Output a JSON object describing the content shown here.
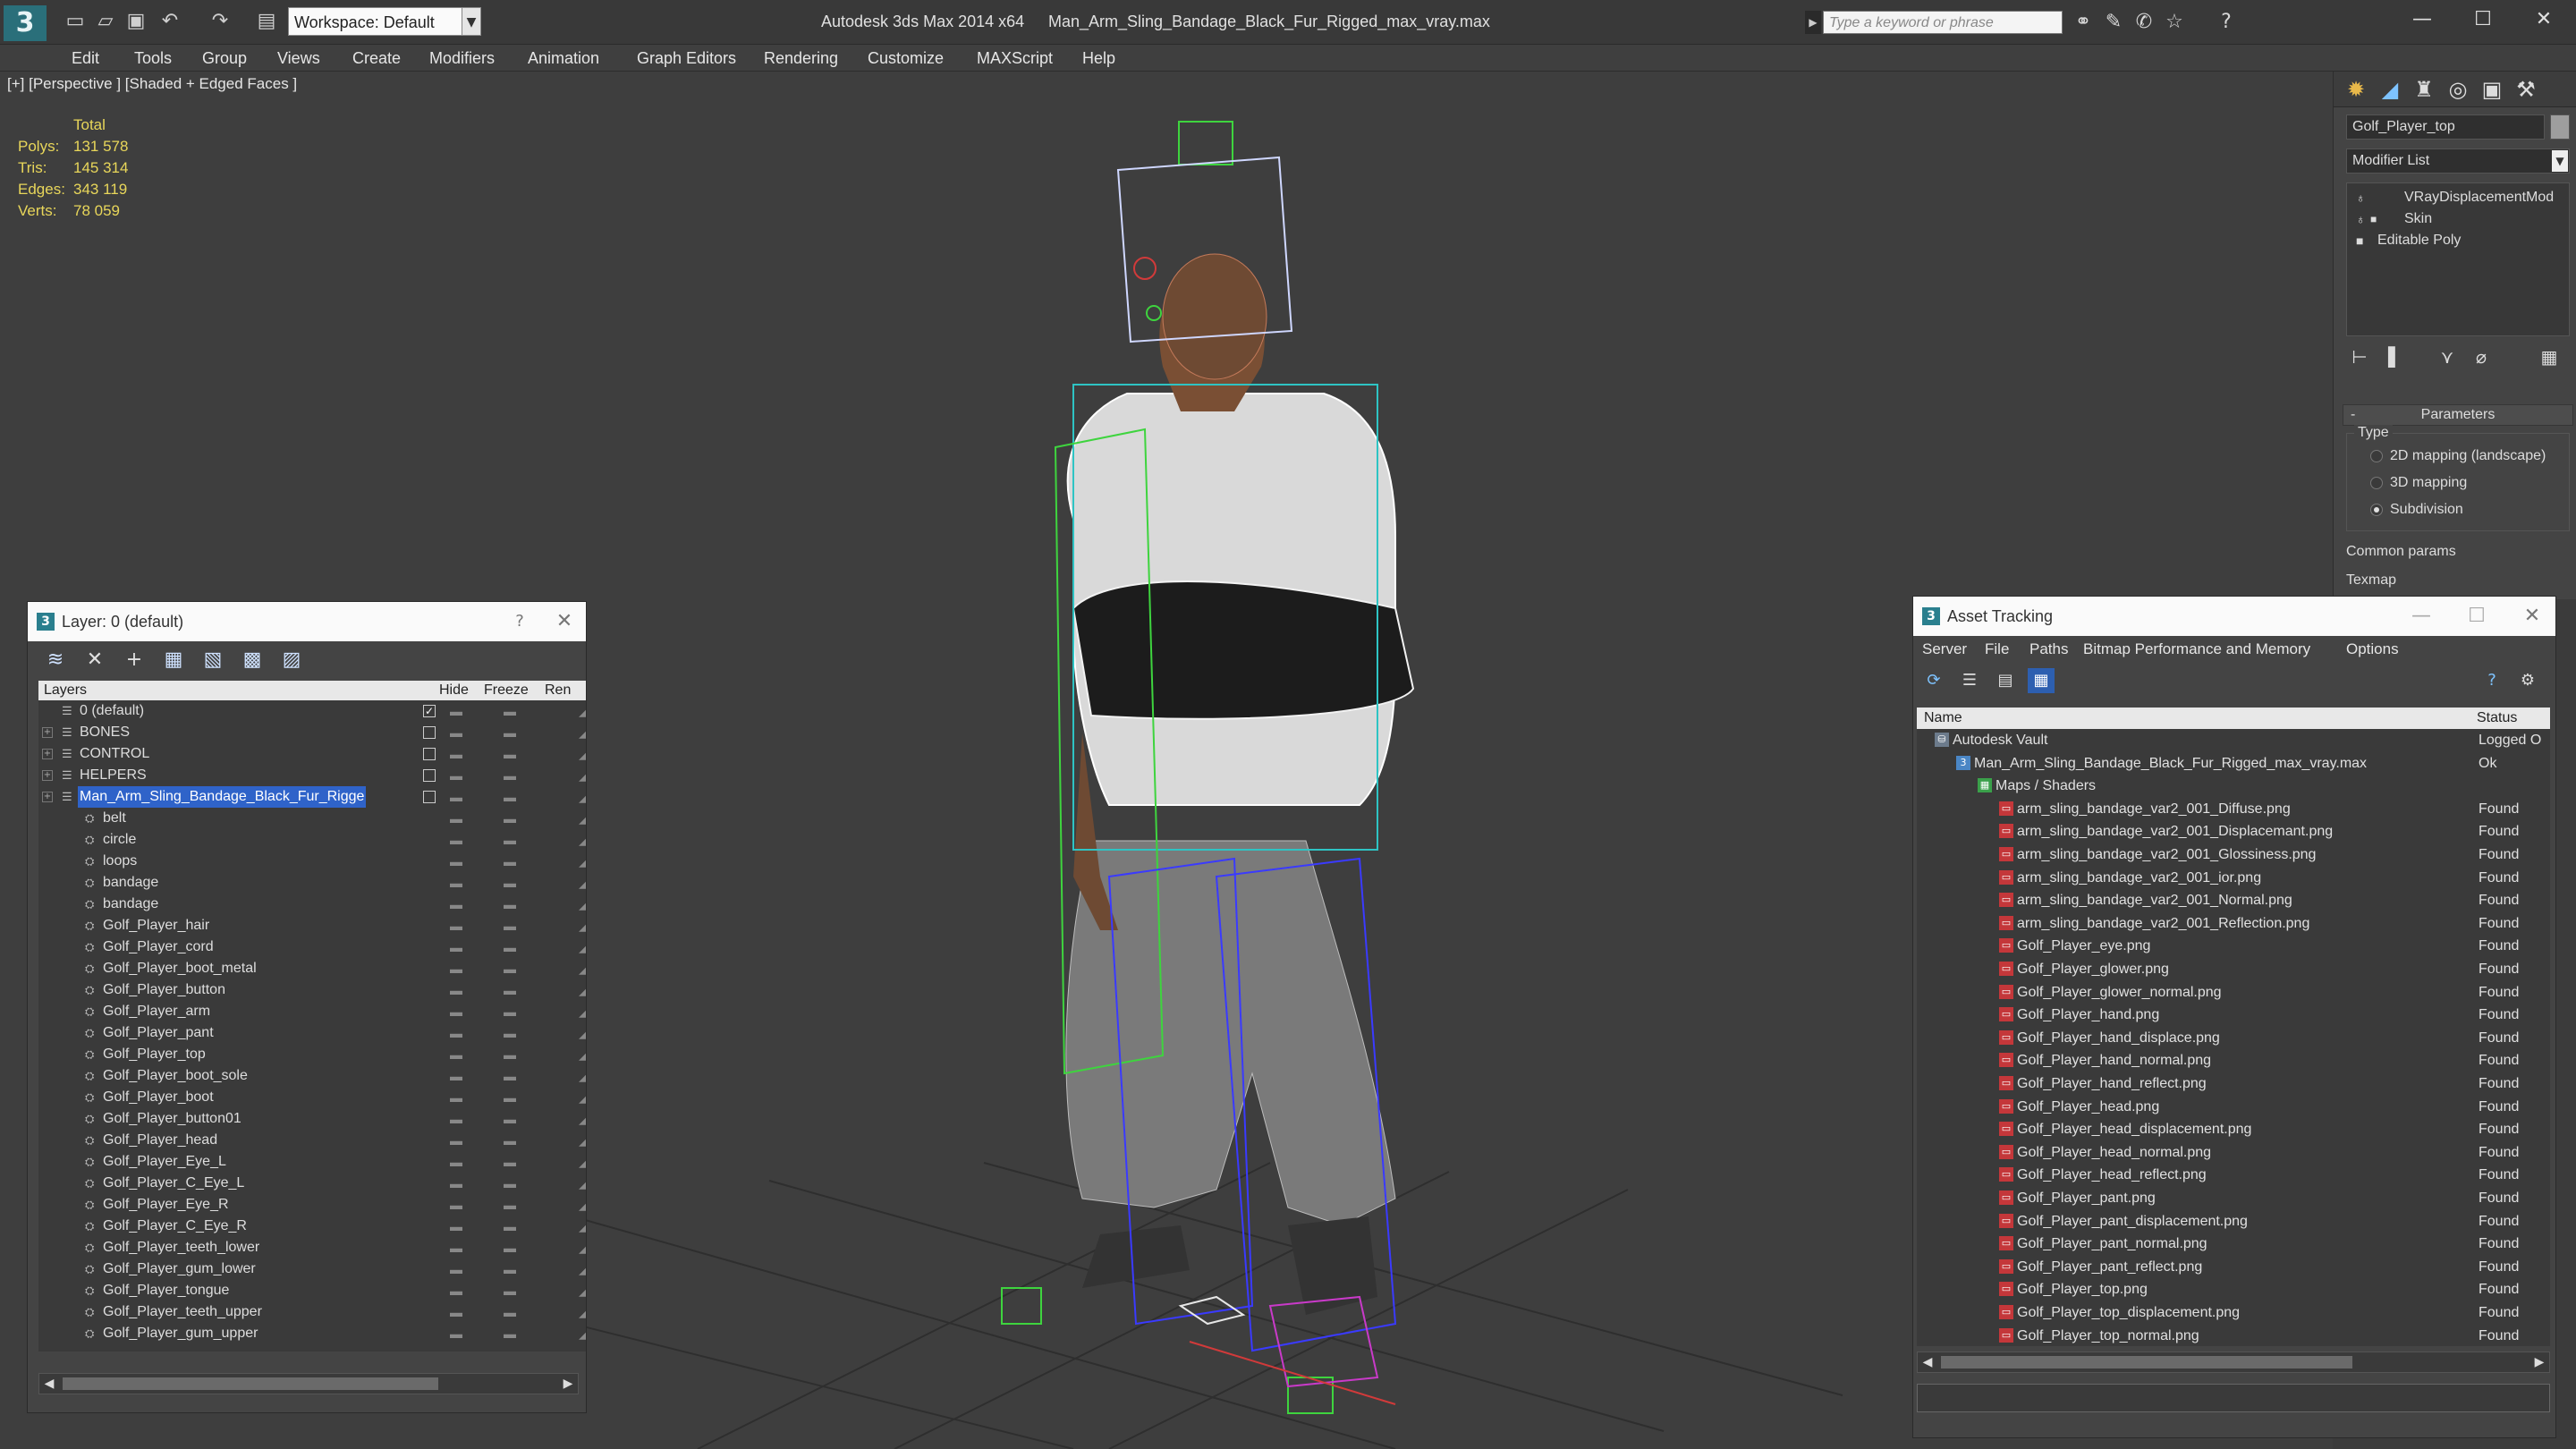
{
  "titlebar": {
    "app_title": "Autodesk 3ds Max  2014 x64",
    "file_name": "Man_Arm_Sling_Bandage_Black_Fur_Rigged_max_vray.max",
    "workspace": "Workspace: Default",
    "search_placeholder": "Type a keyword or phrase"
  },
  "menu": [
    "Edit",
    "Tools",
    "Group",
    "Views",
    "Create",
    "Modifiers",
    "Animation",
    "Graph Editors",
    "Rendering",
    "Customize",
    "MAXScript",
    "Help"
  ],
  "viewport": {
    "label": "[+] [Perspective ] [Shaded + Edged Faces ]",
    "stats": {
      "total_label": "Total",
      "polys_label": "Polys:",
      "polys": "131 578",
      "tris_label": "Tris:",
      "tris": "145 314",
      "edges_label": "Edges:",
      "edges": "343 119",
      "verts_label": "Verts:",
      "verts": "78 059"
    }
  },
  "command_panel": {
    "object_name": "Golf_Player_top",
    "modifier_list": "Modifier List",
    "stack": [
      "VRayDisplacementMod",
      "Skin",
      "Editable Poly"
    ],
    "parameters_title": "Parameters",
    "type_title": "Type",
    "type_options": [
      "2D mapping (landscape)",
      "3D mapping",
      "Subdivision"
    ],
    "selected_type": "Subdivision",
    "common_params": "Common params",
    "texmap": "Texmap"
  },
  "layer_dialog": {
    "title": "Layer: 0 (default)",
    "help": "?",
    "columns": {
      "layers": "Layers",
      "hide": "Hide",
      "freeze": "Freeze",
      "render": "Ren"
    },
    "layers": [
      {
        "name": "0 (default)",
        "type": "layer",
        "current": true
      },
      {
        "name": "BONES",
        "type": "layer"
      },
      {
        "name": "CONTROL",
        "type": "layer"
      },
      {
        "name": "HELPERS",
        "type": "layer"
      },
      {
        "name": "Man_Arm_Sling_Bandage_Black_Fur_Rigge",
        "type": "layer",
        "selected": true
      },
      {
        "name": "belt",
        "type": "object"
      },
      {
        "name": "circle",
        "type": "object"
      },
      {
        "name": "loops",
        "type": "object"
      },
      {
        "name": "bandage",
        "type": "object"
      },
      {
        "name": "bandage",
        "type": "object"
      },
      {
        "name": "Golf_Player_hair",
        "type": "object"
      },
      {
        "name": "Golf_Player_cord",
        "type": "object"
      },
      {
        "name": "Golf_Player_boot_metal",
        "type": "object"
      },
      {
        "name": "Golf_Player_button",
        "type": "object"
      },
      {
        "name": "Golf_Player_arm",
        "type": "object"
      },
      {
        "name": "Golf_Player_pant",
        "type": "object"
      },
      {
        "name": "Golf_Player_top",
        "type": "object"
      },
      {
        "name": "Golf_Player_boot_sole",
        "type": "object"
      },
      {
        "name": "Golf_Player_boot",
        "type": "object"
      },
      {
        "name": "Golf_Player_button01",
        "type": "object"
      },
      {
        "name": "Golf_Player_head",
        "type": "object"
      },
      {
        "name": "Golf_Player_Eye_L",
        "type": "object"
      },
      {
        "name": "Golf_Player_C_Eye_L",
        "type": "object"
      },
      {
        "name": "Golf_Player_Eye_R",
        "type": "object"
      },
      {
        "name": "Golf_Player_C_Eye_R",
        "type": "object"
      },
      {
        "name": "Golf_Player_teeth_lower",
        "type": "object"
      },
      {
        "name": "Golf_Player_gum_lower",
        "type": "object"
      },
      {
        "name": "Golf_Player_tongue",
        "type": "object"
      },
      {
        "name": "Golf_Player_teeth_upper",
        "type": "object"
      },
      {
        "name": "Golf_Player_gum_upper",
        "type": "object"
      }
    ]
  },
  "asset_dialog": {
    "title": "Asset Tracking",
    "menu": [
      "Server",
      "File",
      "Paths",
      "Bitmap Performance and Memory",
      "Options"
    ],
    "columns": {
      "name": "Name",
      "status": "Status"
    },
    "rows": [
      {
        "name": "Autodesk Vault",
        "status": "Logged O",
        "level": 0,
        "kind": "vault"
      },
      {
        "name": "Man_Arm_Sling_Bandage_Black_Fur_Rigged_max_vray.max",
        "status": "Ok",
        "level": 1,
        "kind": "file"
      },
      {
        "name": "Maps / Shaders",
        "status": "",
        "level": 2,
        "kind": "folder"
      },
      {
        "name": "arm_sling_bandage_var2_001_Diffuse.png",
        "status": "Found",
        "level": 3,
        "kind": "map"
      },
      {
        "name": "arm_sling_bandage_var2_001_Displacemant.png",
        "status": "Found",
        "level": 3,
        "kind": "map"
      },
      {
        "name": "arm_sling_bandage_var2_001_Glossiness.png",
        "status": "Found",
        "level": 3,
        "kind": "map"
      },
      {
        "name": "arm_sling_bandage_var2_001_ior.png",
        "status": "Found",
        "level": 3,
        "kind": "map"
      },
      {
        "name": "arm_sling_bandage_var2_001_Normal.png",
        "status": "Found",
        "level": 3,
        "kind": "map"
      },
      {
        "name": "arm_sling_bandage_var2_001_Reflection.png",
        "status": "Found",
        "level": 3,
        "kind": "map"
      },
      {
        "name": "Golf_Player_eye.png",
        "status": "Found",
        "level": 3,
        "kind": "map"
      },
      {
        "name": "Golf_Player_glower.png",
        "status": "Found",
        "level": 3,
        "kind": "map"
      },
      {
        "name": "Golf_Player_glower_normal.png",
        "status": "Found",
        "level": 3,
        "kind": "map"
      },
      {
        "name": "Golf_Player_hand.png",
        "status": "Found",
        "level": 3,
        "kind": "map"
      },
      {
        "name": "Golf_Player_hand_displace.png",
        "status": "Found",
        "level": 3,
        "kind": "map"
      },
      {
        "name": "Golf_Player_hand_normal.png",
        "status": "Found",
        "level": 3,
        "kind": "map"
      },
      {
        "name": "Golf_Player_hand_reflect.png",
        "status": "Found",
        "level": 3,
        "kind": "map"
      },
      {
        "name": "Golf_Player_head.png",
        "status": "Found",
        "level": 3,
        "kind": "map"
      },
      {
        "name": "Golf_Player_head_displacement.png",
        "status": "Found",
        "level": 3,
        "kind": "map"
      },
      {
        "name": "Golf_Player_head_normal.png",
        "status": "Found",
        "level": 3,
        "kind": "map"
      },
      {
        "name": "Golf_Player_head_reflect.png",
        "status": "Found",
        "level": 3,
        "kind": "map"
      },
      {
        "name": "Golf_Player_pant.png",
        "status": "Found",
        "level": 3,
        "kind": "map"
      },
      {
        "name": "Golf_Player_pant_displacement.png",
        "status": "Found",
        "level": 3,
        "kind": "map"
      },
      {
        "name": "Golf_Player_pant_normal.png",
        "status": "Found",
        "level": 3,
        "kind": "map"
      },
      {
        "name": "Golf_Player_pant_reflect.png",
        "status": "Found",
        "level": 3,
        "kind": "map"
      },
      {
        "name": "Golf_Player_top.png",
        "status": "Found",
        "level": 3,
        "kind": "map"
      },
      {
        "name": "Golf_Player_top_displacement.png",
        "status": "Found",
        "level": 3,
        "kind": "map"
      },
      {
        "name": "Golf_Player_top_normal.png",
        "status": "Found",
        "level": 3,
        "kind": "map"
      }
    ]
  },
  "colors": {
    "stats_text": "#e8d65a",
    "selection": "#2f63c9",
    "bone_green": "#3ed43e",
    "bone_blue": "#3a3aff",
    "viewport_bg": "#3e3e3e"
  }
}
